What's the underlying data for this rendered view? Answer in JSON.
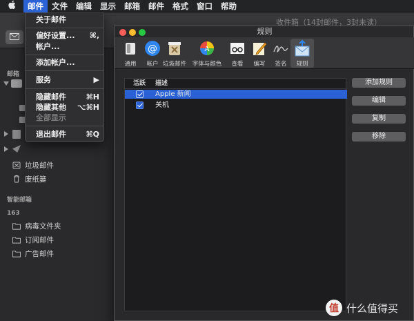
{
  "menubar": {
    "items": [
      {
        "label": "邮件"
      },
      {
        "label": "文件"
      },
      {
        "label": "编辑"
      },
      {
        "label": "显示"
      },
      {
        "label": "邮箱"
      },
      {
        "label": "邮件"
      },
      {
        "label": "格式"
      },
      {
        "label": "窗口"
      },
      {
        "label": "帮助"
      }
    ]
  },
  "main_window": {
    "title": "收件箱（14封邮件，3封未读）"
  },
  "mail_menu": {
    "items": [
      {
        "label": "关于邮件",
        "shortcut": ""
      },
      {
        "label": "偏好设置...",
        "shortcut": "⌘,"
      },
      {
        "label": "帐户...",
        "shortcut": ""
      },
      {
        "label": "添加帐户...",
        "shortcut": ""
      },
      {
        "label": "服务",
        "shortcut": "▶"
      },
      {
        "label": "隐藏邮件",
        "shortcut": "⌘H"
      },
      {
        "label": "隐藏其他",
        "shortcut": "⌥⌘H"
      },
      {
        "label": "全部显示",
        "shortcut": ""
      },
      {
        "label": "退出邮件",
        "shortcut": "⌘Q"
      }
    ]
  },
  "sidebar": {
    "section_mailboxes": "邮箱",
    "junk": "垃圾邮件",
    "trash": "废纸篓",
    "section_smart": "智能邮箱",
    "section_account": "163",
    "folders": [
      {
        "label": "病毒文件夹"
      },
      {
        "label": "订阅邮件"
      },
      {
        "label": "广告邮件"
      }
    ]
  },
  "rules_window": {
    "title": "规则",
    "toolbar": [
      {
        "label": "通用",
        "icon": "switch-icon"
      },
      {
        "label": "帐户",
        "icon": "at-sign-icon"
      },
      {
        "label": "垃圾邮件",
        "icon": "junk-bin-icon"
      },
      {
        "label": "字体与颜色",
        "icon": "color-wheel-icon"
      },
      {
        "label": "查看",
        "icon": "glasses-icon"
      },
      {
        "label": "编写",
        "icon": "pencil-paper-icon"
      },
      {
        "label": "签名",
        "icon": "signature-icon"
      },
      {
        "label": "规则",
        "icon": "rules-envelope-icon"
      }
    ],
    "table": {
      "col_active": "活跃",
      "col_desc": "描述",
      "rows": [
        {
          "active": true,
          "desc": "Apple 新闻"
        },
        {
          "active": true,
          "desc": "关机"
        }
      ]
    },
    "buttons": {
      "add": "添加规则",
      "edit": "编辑",
      "copy": "复制",
      "remove": "移除"
    }
  },
  "watermark": {
    "logo": "值",
    "text": "什么值得买"
  }
}
